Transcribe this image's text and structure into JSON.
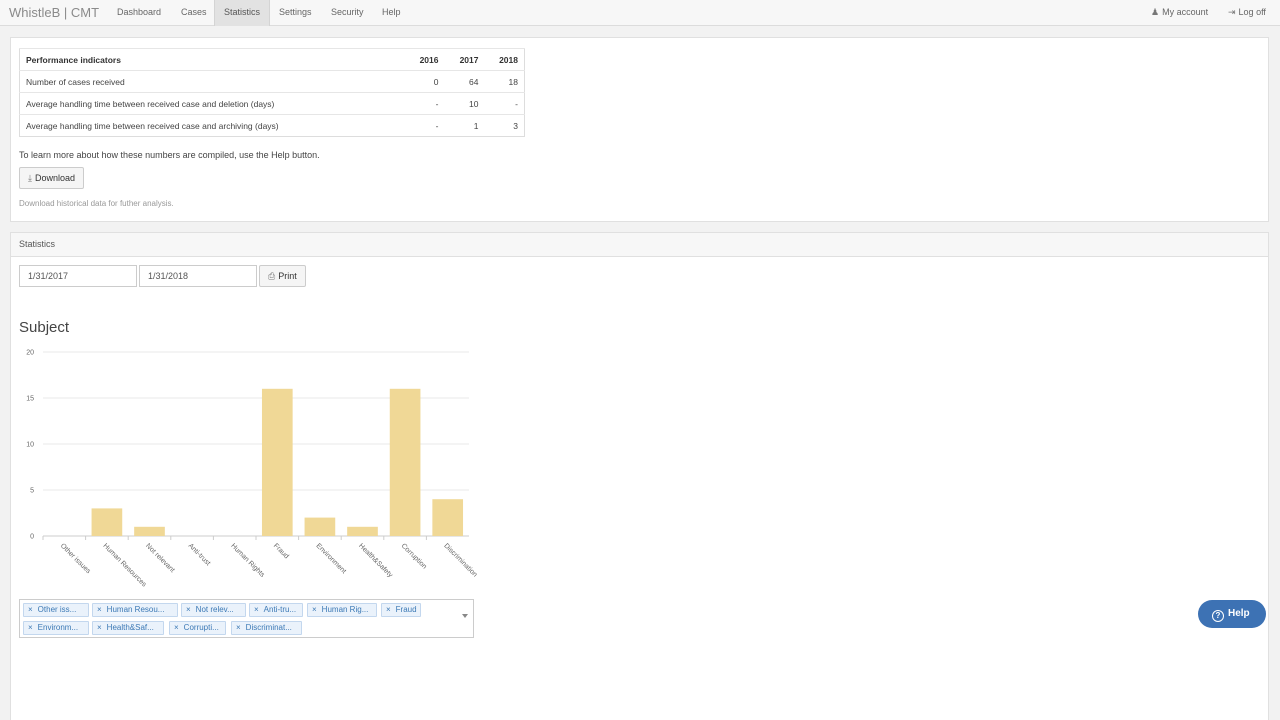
{
  "nav": {
    "brand": "WhistleB | CMT",
    "items": [
      {
        "label": "Dashboard"
      },
      {
        "label": "Cases"
      },
      {
        "label": "Statistics"
      },
      {
        "label": "Settings"
      },
      {
        "label": "Security"
      },
      {
        "label": "Help"
      }
    ],
    "active_index": 2,
    "my_account": "My account",
    "log_off": "Log off"
  },
  "performance": {
    "headers": [
      "Performance indicators",
      "2016",
      "2017",
      "2018"
    ],
    "rows": [
      {
        "label": "Number of cases received",
        "v2016": "0",
        "v2017": "64",
        "v2018": "18"
      },
      {
        "label": "Average handling time between received case and deletion (days)",
        "v2016": "-",
        "v2017": "10",
        "v2018": "-"
      },
      {
        "label": "Average handling time between received case and archiving (days)",
        "v2016": "-",
        "v2017": "1",
        "v2018": "3"
      }
    ],
    "help_text": "To learn more about how these numbers are compiled, use the Help button.",
    "download_label": "Download",
    "download_note": "Download historical data for futher analysis."
  },
  "statistics": {
    "heading": "Statistics",
    "date_from": "1/31/2017",
    "date_to": "1/31/2018",
    "print_label": "Print",
    "subject_title": "Subject"
  },
  "chart_data": {
    "type": "bar",
    "title": "Subject",
    "categories": [
      "Other issues",
      "Human Resources",
      "Not relevant",
      "Anti-trust",
      "Human Rights",
      "Fraud",
      "Environment",
      "Health&Safety",
      "Corruption",
      "Discrimination"
    ],
    "values": [
      0,
      3,
      1,
      0,
      0,
      16,
      2,
      1,
      16,
      4
    ],
    "ylim": [
      0,
      20
    ],
    "yticks": [
      0,
      5,
      10,
      15,
      20
    ],
    "grid": true,
    "bar_color": "#f0d896"
  },
  "filter_chips": [
    "Other iss...",
    "Human Resou...",
    "Not relev...",
    "Anti-tru...",
    "Human Rig...",
    "Fraud",
    "Environm...",
    "Health&Saf...",
    "Corrupti...",
    "Discriminat..."
  ],
  "help_button": "Help",
  "colors": {
    "accent": "#3d72b4",
    "chip_text": "#3c79b5",
    "bar": "#f0d896"
  }
}
